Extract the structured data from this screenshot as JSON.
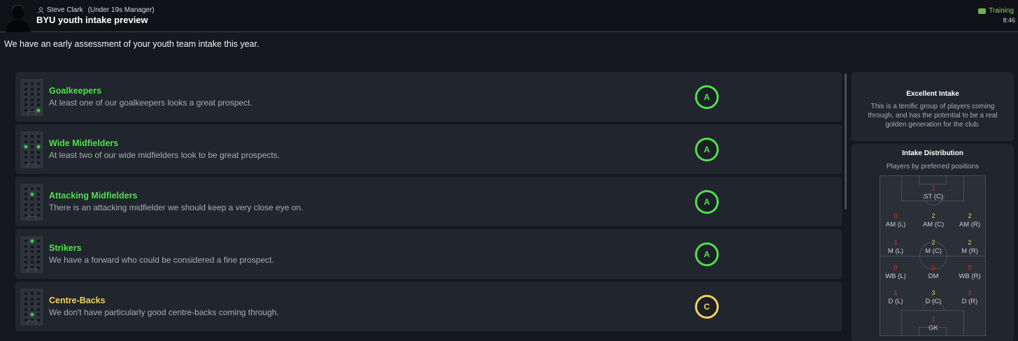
{
  "header": {
    "manager_name": "Steve Clark",
    "manager_role": "(Under 19s Manager)",
    "title": "BYU youth intake preview",
    "status": "Training",
    "time": "8:46"
  },
  "intro": "We have an early assessment of your youth team intake this year.",
  "colors": {
    "green": "#4fe04a",
    "yellow": "#f2d25a",
    "red": "#e0322e"
  },
  "rows": [
    {
      "title": "Goalkeepers",
      "desc": "At least one of our goalkeepers looks a great prospect.",
      "grade": "A"
    },
    {
      "title": "Wide Midfielders",
      "desc": "At least two of our wide midfielders look to be great prospects.",
      "grade": "A"
    },
    {
      "title": "Attacking Midfielders",
      "desc": "There is an attacking midfielder we should keep a very close eye on.",
      "grade": "A"
    },
    {
      "title": "Strikers",
      "desc": "We have a forward who could be considered a fine prospect.",
      "grade": "A"
    },
    {
      "title": "Centre-Backs",
      "desc": "We don't have particularly good centre-backs coming through.",
      "grade": "C"
    }
  ],
  "summary": {
    "title": "Excellent Intake",
    "text": "This is a terrific group of players coming through, and has the potential to be a real golden generation for the club."
  },
  "distribution": {
    "title": "Intake Distribution",
    "subtitle": "Players by preferred positions",
    "positions": [
      {
        "label": "ST (C)",
        "count": "1"
      },
      {
        "label": "AM (L)",
        "count": "0"
      },
      {
        "label": "AM (C)",
        "count": "2"
      },
      {
        "label": "AM (R)",
        "count": "2"
      },
      {
        "label": "M (L)",
        "count": "1"
      },
      {
        "label": "M (C)",
        "count": "2"
      },
      {
        "label": "M (R)",
        "count": "2"
      },
      {
        "label": "WB (L)",
        "count": "0"
      },
      {
        "label": "DM",
        "count": "0"
      },
      {
        "label": "WB (R)",
        "count": "0"
      },
      {
        "label": "D (L)",
        "count": "1"
      },
      {
        "label": "D (C)",
        "count": "3"
      },
      {
        "label": "D (R)",
        "count": "1"
      },
      {
        "label": "GK",
        "count": "1"
      }
    ]
  }
}
